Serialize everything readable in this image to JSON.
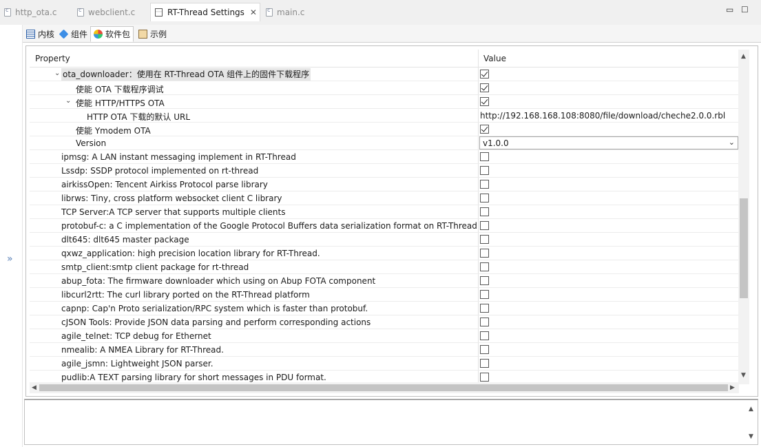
{
  "editor_tabs": [
    {
      "label": "http_ota.c",
      "active": false
    },
    {
      "label": "webclient.c",
      "active": false
    },
    {
      "label": "RT-Thread Settings",
      "active": true
    },
    {
      "label": "main.c",
      "active": false
    }
  ],
  "window_controls": {
    "minimize": "▭",
    "maximize": "☐"
  },
  "inner_tabs": [
    {
      "label": "内核",
      "icon": "kernel-icon"
    },
    {
      "label": "组件",
      "icon": "component-icon"
    },
    {
      "label": "软件包",
      "icon": "package-icon",
      "active": true
    },
    {
      "label": "示例",
      "icon": "example-icon"
    }
  ],
  "gutter": {
    "expand_glyph": "»"
  },
  "table": {
    "headers": {
      "property": "Property",
      "value": "Value"
    },
    "rows": [
      {
        "label": "ota_downloader：使用在 RT-Thread OTA 组件上的固件下载程序",
        "type": "checkbox",
        "checked": true,
        "twisty": "expanded"
      },
      {
        "label": "使能 OTA 下载程序调试",
        "type": "checkbox",
        "checked": true
      },
      {
        "label": "使能  HTTP/HTTPS OTA",
        "type": "checkbox",
        "checked": true,
        "twisty": "expanded"
      },
      {
        "label": "HTTP OTA 下载的默认 URL",
        "type": "text",
        "value": "http://192.168.168.108:8080/file/download/cheche2.0.0.rbl"
      },
      {
        "label": "使能 Ymodem OTA",
        "type": "checkbox",
        "checked": true
      },
      {
        "label": "Version",
        "type": "select",
        "value": "v1.0.0"
      },
      {
        "label": "ipmsg: A LAN instant messaging implement in RT-Thread",
        "type": "checkbox",
        "checked": false
      },
      {
        "label": "Lssdp: SSDP protocol implemented on rt-thread",
        "type": "checkbox",
        "checked": false
      },
      {
        "label": "airkissOpen: Tencent Airkiss Protocol parse library",
        "type": "checkbox",
        "checked": false
      },
      {
        "label": "librws: Tiny, cross platform websocket client C library",
        "type": "checkbox",
        "checked": false
      },
      {
        "label": "TCP Server:A TCP server that supports multiple clients",
        "type": "checkbox",
        "checked": false
      },
      {
        "label": "protobuf-c: a C implementation of the Google Protocol Buffers data serialization format on RT-Thread",
        "type": "checkbox",
        "checked": false
      },
      {
        "label": "dlt645: dlt645 master package",
        "type": "checkbox",
        "checked": false
      },
      {
        "label": "qxwz_application: high precision location library for RT-Thread.",
        "type": "checkbox",
        "checked": false
      },
      {
        "label": "smtp_client:smtp client package for rt-thread",
        "type": "checkbox",
        "checked": false
      },
      {
        "label": "abup_fota: The firmware downloader which using on Abup FOTA component",
        "type": "checkbox",
        "checked": false
      },
      {
        "label": "libcurl2rtt: The curl library ported on the RT-Thread platform",
        "type": "checkbox",
        "checked": false
      },
      {
        "label": "capnp: Cap'n Proto serialization/RPC system which is faster than protobuf.",
        "type": "checkbox",
        "checked": false
      },
      {
        "label": "cJSON Tools: Provide JSON data parsing and perform corresponding actions",
        "type": "checkbox",
        "checked": false
      },
      {
        "label": "agile_telnet: TCP debug for Ethernet",
        "type": "checkbox",
        "checked": false
      },
      {
        "label": "nmealib: A NMEA Library for RT-Thread.",
        "type": "checkbox",
        "checked": false
      },
      {
        "label": "agile_jsmn: Lightweight JSON parser.",
        "type": "checkbox",
        "checked": false
      },
      {
        "label": "pudlib:A TEXT parsing library for short messages in PDU format.",
        "type": "checkbox",
        "checked": false
      }
    ]
  },
  "glyphs": {
    "twisty_expanded": "⌄",
    "dropdown": "⌄",
    "up": "▲",
    "down": "▼",
    "left": "◀",
    "right": "▶"
  }
}
